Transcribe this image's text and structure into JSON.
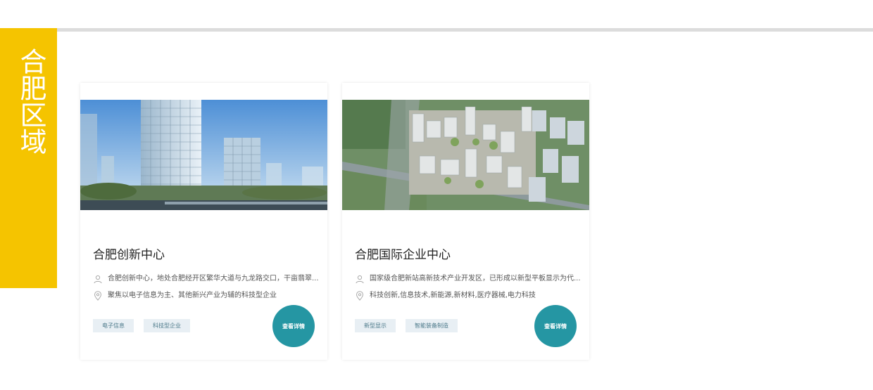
{
  "region": {
    "title": "合肥区域",
    "accent_color": "#f5c400"
  },
  "cards": [
    {
      "title": "合肥创新中心",
      "image": "modern-office-towers-photo",
      "address": "合肥创新中心，地处合肥经开区繁华大道与九龙路交口，干亩翡翠...",
      "industry": "聚焦以电子信息为主、其他新兴产业为辅的科技型企业",
      "tags": [
        "电子信息",
        "科技型企业"
      ],
      "detail_label": "查看详情"
    },
    {
      "title": "合肥国际企业中心",
      "image": "aerial-industrial-park-photo",
      "address": "国家级合肥新站高新技术产业开发区，已形成以新型平板显示为代...",
      "industry": "科技创新,信息技术,新能源,新材料,医疗器械,电力科技",
      "tags": [
        "新型显示",
        "智能装备制造"
      ],
      "detail_label": "查看详情"
    }
  ],
  "icons": {
    "address": "person-location-icon",
    "industry": "map-pin-icon"
  },
  "colors": {
    "button": "#2596a3",
    "tag_bg": "#e8eff4",
    "tag_text": "#4d7a8a",
    "rule": "#dcdcdc"
  }
}
